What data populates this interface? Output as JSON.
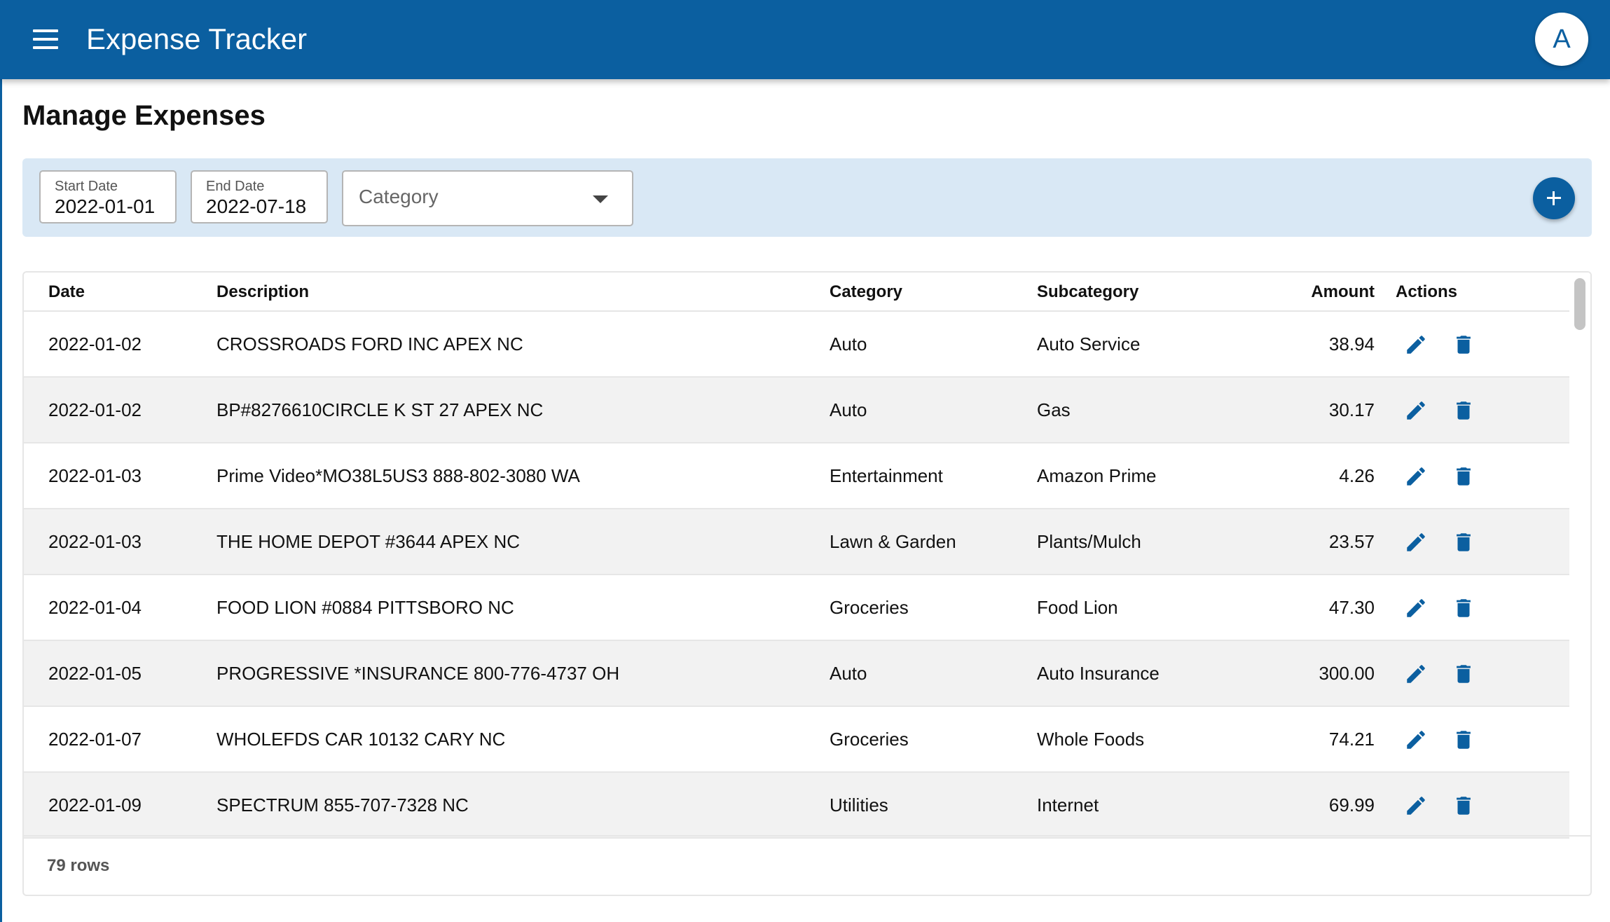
{
  "app": {
    "title": "Expense Tracker",
    "avatar_initial": "A",
    "accent_color": "#0b5fa0"
  },
  "page": {
    "title": "Manage Expenses"
  },
  "filters": {
    "start_date": {
      "label": "Start Date",
      "value": "2022-01-01"
    },
    "end_date": {
      "label": "End Date",
      "value": "2022-07-18"
    },
    "category": {
      "placeholder": "Category",
      "value": ""
    },
    "add_icon": "plus-icon"
  },
  "table": {
    "columns": {
      "date": "Date",
      "description": "Description",
      "category": "Category",
      "subcategory": "Subcategory",
      "amount": "Amount",
      "actions": "Actions"
    },
    "rows": [
      {
        "date": "2022-01-02",
        "description": "CROSSROADS FORD INC APEX NC",
        "category": "Auto",
        "subcategory": "Auto Service",
        "amount": "38.94"
      },
      {
        "date": "2022-01-02",
        "description": "BP#8276610CIRCLE K ST 27 APEX NC",
        "category": "Auto",
        "subcategory": "Gas",
        "amount": "30.17"
      },
      {
        "date": "2022-01-03",
        "description": "Prime Video*MO38L5US3 888-802-3080 WA",
        "category": "Entertainment",
        "subcategory": "Amazon Prime",
        "amount": "4.26"
      },
      {
        "date": "2022-01-03",
        "description": "THE HOME DEPOT #3644 APEX NC",
        "category": "Lawn & Garden",
        "subcategory": "Plants/Mulch",
        "amount": "23.57"
      },
      {
        "date": "2022-01-04",
        "description": "FOOD LION #0884 PITTSBORO NC",
        "category": "Groceries",
        "subcategory": "Food Lion",
        "amount": "47.30"
      },
      {
        "date": "2022-01-05",
        "description": "PROGRESSIVE *INSURANCE 800-776-4737 OH",
        "category": "Auto",
        "subcategory": "Auto Insurance",
        "amount": "300.00"
      },
      {
        "date": "2022-01-07",
        "description": "WHOLEFDS CAR 10132 CARY NC",
        "category": "Groceries",
        "subcategory": "Whole Foods",
        "amount": "74.21"
      },
      {
        "date": "2022-01-09",
        "description": "SPECTRUM 855-707-7328 NC",
        "category": "Utilities",
        "subcategory": "Internet",
        "amount": "69.99"
      }
    ],
    "row_icons": {
      "edit": "pencil-icon",
      "delete": "trash-icon"
    },
    "footer": {
      "row_count": "79 rows"
    }
  }
}
